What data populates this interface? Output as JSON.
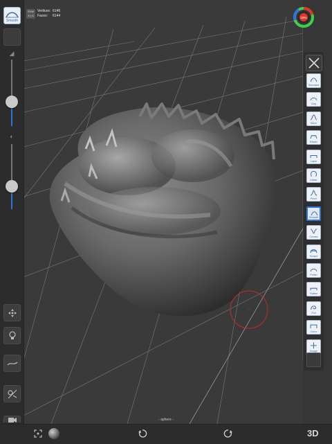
{
  "header": {
    "sym_label": "SYM",
    "axis_label": "X | X",
    "vertices_label": "Vertices:",
    "vertices_value": "6146",
    "faces_label": "Faces:",
    "faces_value": "6144"
  },
  "gauge": {
    "text": "28%",
    "ring_colors": [
      "#3fcf4a",
      "#e2342b",
      "#2f74d8"
    ]
  },
  "left_toolbar": {
    "active_brush_label": "Smooth",
    "slider_top_value": 0.35,
    "slider_bottom_value": 0.3,
    "buttons": [
      "move-icon",
      "lightbulb-icon",
      "stroke-icon",
      "mask-icon",
      "camera-icon"
    ]
  },
  "brushes": [
    {
      "label": "Standard"
    },
    {
      "label": "Clay"
    },
    {
      "label": "Move"
    },
    {
      "label": "Elastic"
    },
    {
      "label": "Layer"
    },
    {
      "label": "Inflate"
    },
    {
      "label": "Pinch"
    },
    {
      "label": "Smooth"
    },
    {
      "label": "Crease"
    },
    {
      "label": "Scrape"
    },
    {
      "label": "Polish"
    },
    {
      "label": "Flatten"
    },
    {
      "label": "Pull"
    },
    {
      "label": "Clone"
    },
    {
      "label": "Nudge"
    }
  ],
  "active_brush_index": 7,
  "mesh_name": "- sphere -",
  "bottom": {
    "mode_label": "3D"
  },
  "colors": {
    "accent": "#2f74d8",
    "background": "#363636",
    "cursor_ring": "#c42a2a"
  }
}
